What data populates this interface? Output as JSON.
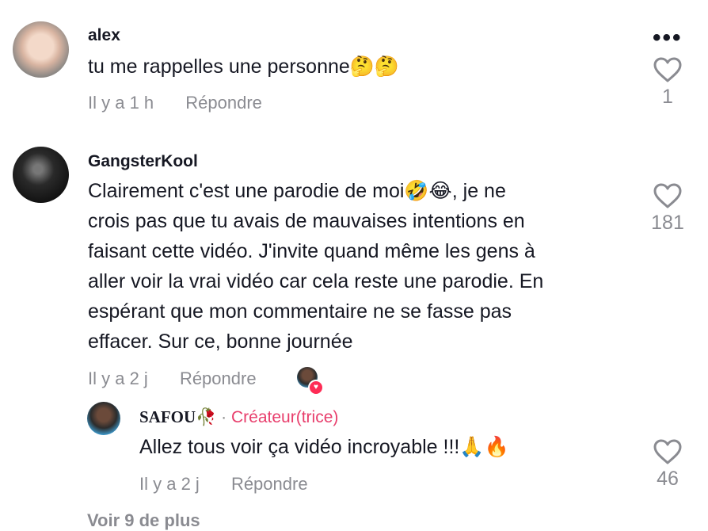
{
  "comments": [
    {
      "username": "alex",
      "text": "tu me rappelles une personne🤔🤔",
      "time": "Il y a 1 h",
      "reply_label": "Répondre",
      "likes": "1"
    },
    {
      "username": "GangsterKool",
      "text_lines": [
        "Clairement c'est une parodie de moi🤣😂, je ne",
        "crois pas que tu avais de mauvaises intentions en",
        "faisant cette vidéo. J'invite quand même les gens à",
        "aller voir la vrai vidéo car cela reste une parodie. En",
        "espérant que mon commentaire ne se fasse pas",
        "effacer. Sur ce, bonne journée"
      ],
      "time": "Il y a 2 j",
      "reply_label": "Répondre",
      "likes": "181"
    }
  ],
  "reply": {
    "username": "SAFOU🥀",
    "separator": "·",
    "creator_badge": "Créateur(trice)",
    "text": "Allez tous voir ça vidéo incroyable !!!🙏🔥",
    "time": "Il y a 2 j",
    "reply_label": "Répondre",
    "likes": "46"
  },
  "view_more": "Voir 9 de plus"
}
